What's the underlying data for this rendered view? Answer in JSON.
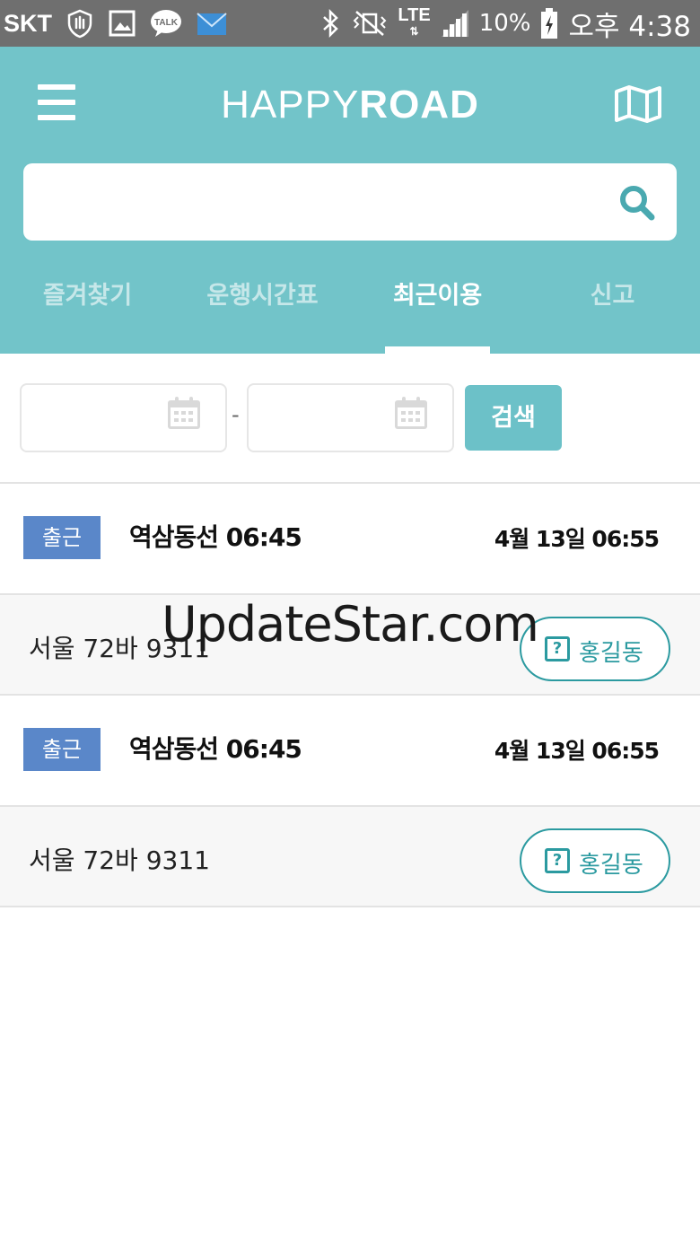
{
  "status_bar": {
    "carrier": "SKT",
    "network": "LTE",
    "battery": "10%",
    "time": "오후 4:38",
    "icons": [
      "shield-hand-icon",
      "gallery-icon",
      "talk-icon",
      "mail-icon",
      "bluetooth-icon",
      "vibrate-mute-icon",
      "signal-icon",
      "battery-charging-icon"
    ],
    "talk_label": "TALK"
  },
  "header": {
    "logo_light": "HAPPY",
    "logo_bold": "ROAD",
    "menu_icon": "hamburger-menu-icon",
    "map_icon": "map-icon",
    "background": "#72c4c9"
  },
  "search": {
    "value": "",
    "placeholder": "",
    "icon": "search-icon"
  },
  "tabs": [
    {
      "label": "즐겨찾기",
      "active": false
    },
    {
      "label": "운행시간표",
      "active": false
    },
    {
      "label": "최근이용",
      "active": true
    },
    {
      "label": "신고",
      "active": false
    }
  ],
  "filter": {
    "start_date": "",
    "end_date": "",
    "separator": "-",
    "search_label": "검색"
  },
  "records": [
    {
      "badge": "출근",
      "route": "역삼동선 06:45",
      "time": "4월 13일 06:55",
      "plate": "서울 72바 9311",
      "person": "홍길동"
    },
    {
      "badge": "출근",
      "route": "역삼동선 06:45",
      "time": "4월 13일 06:55",
      "plate": "서울 72바 9311",
      "person": "홍길동"
    }
  ],
  "watermark": "UpdateStar.com",
  "colors": {
    "accent": "#72c4c9",
    "badge": "#5a87c9",
    "person_button": "#2b9aa0"
  }
}
